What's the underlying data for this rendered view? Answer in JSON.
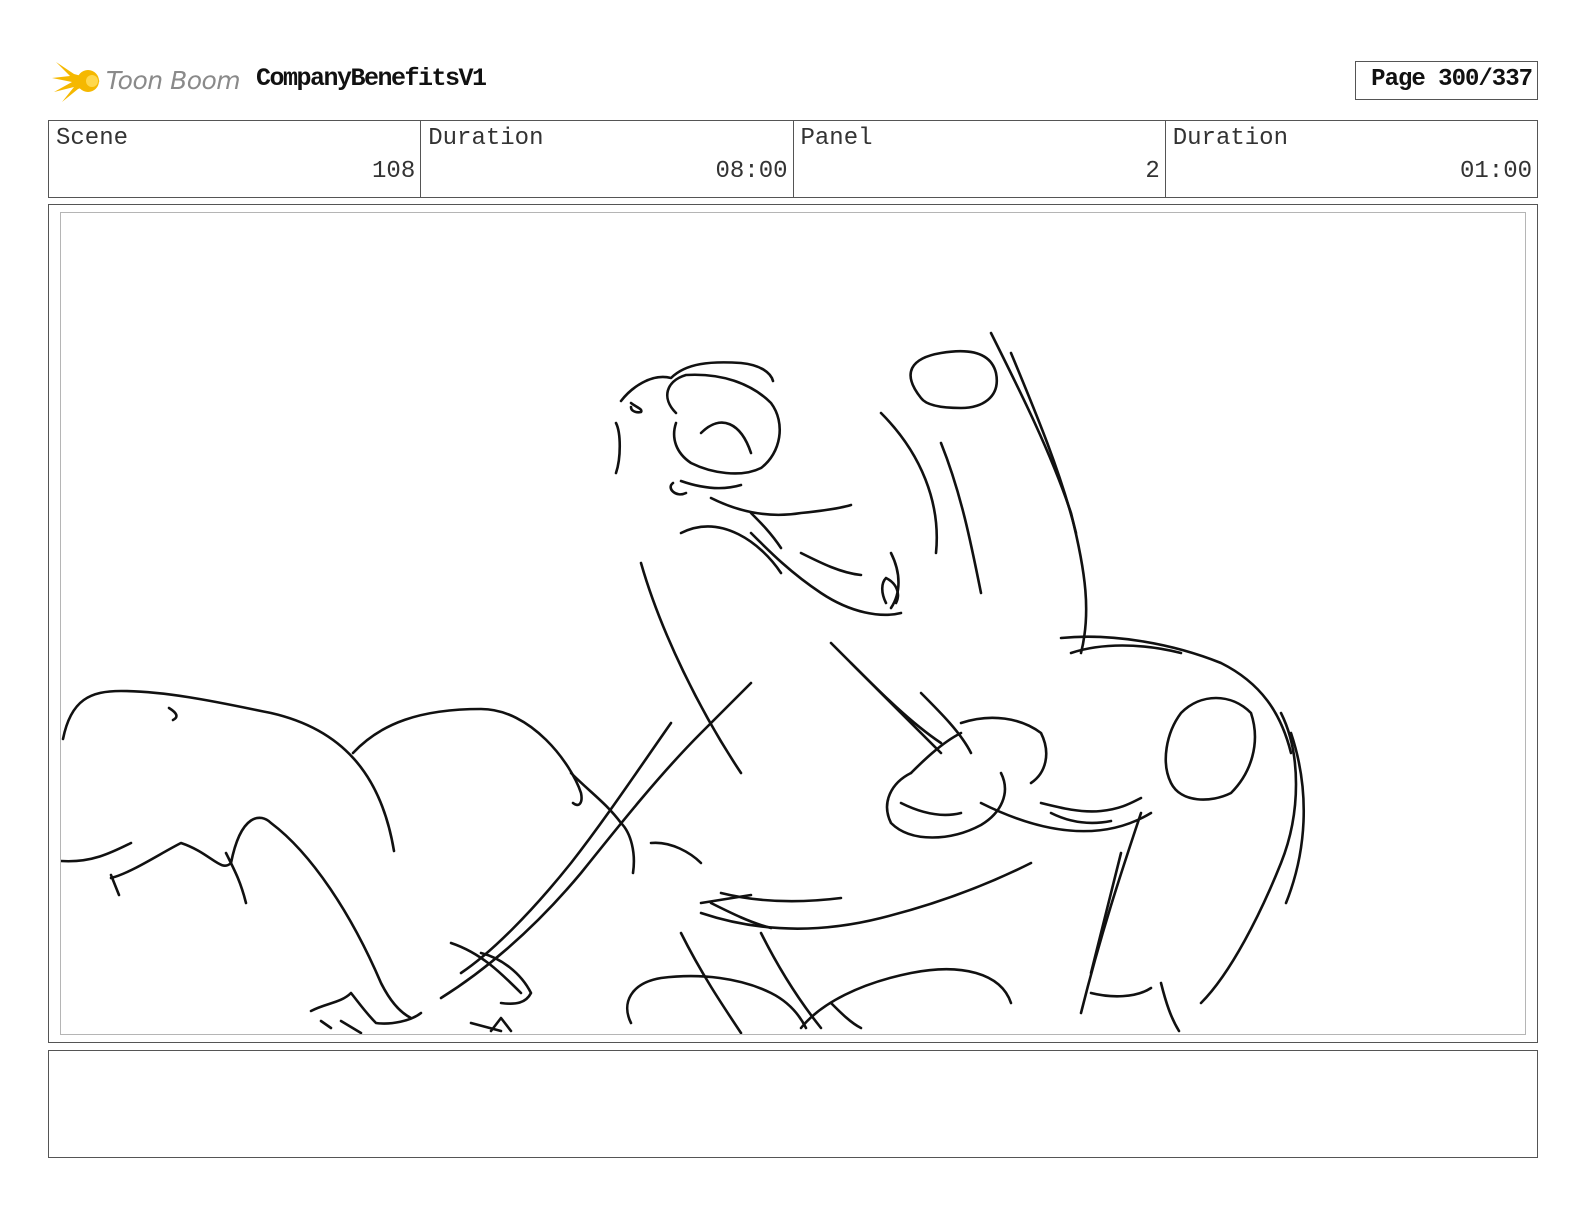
{
  "header": {
    "logo_text": "Toon Boom",
    "logo_icon": "sun-burst-icon",
    "project_title": "CompanyBenefitsV1",
    "page_label": "Page 300/337"
  },
  "info": {
    "scene_label": "Scene",
    "scene_value": "108",
    "scene_duration_label": "Duration",
    "scene_duration_value": "08:00",
    "panel_label": "Panel",
    "panel_value": "2",
    "panel_duration_label": "Duration",
    "panel_duration_value": "01:00"
  },
  "colors": {
    "logo_accent": "#f5b800",
    "sketch_stroke": "#111111"
  }
}
